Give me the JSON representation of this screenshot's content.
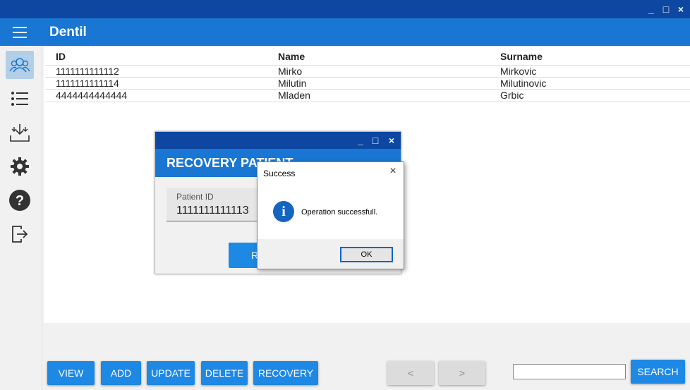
{
  "window": {
    "controls": [
      "_",
      "□",
      "×"
    ]
  },
  "appbar": {
    "title": "Dentil"
  },
  "sidebar": {
    "items": [
      {
        "name": "patients-icon",
        "active": true
      },
      {
        "name": "list-icon"
      },
      {
        "name": "download-icon"
      },
      {
        "name": "gear-icon"
      },
      {
        "name": "help-icon"
      },
      {
        "name": "logout-icon"
      }
    ]
  },
  "table": {
    "headers": [
      "ID",
      "Name",
      "Surname"
    ],
    "rows": [
      [
        "1111111111112",
        "Mirko",
        "Mirkovic"
      ],
      [
        "1111111111114",
        "Milutin",
        "Milutinovic"
      ],
      [
        "4444444444444",
        "Mladen",
        "Grbic"
      ]
    ]
  },
  "buttons": {
    "view": "VIEW",
    "add": "ADD",
    "update": "UPDATE",
    "delete": "DELETE",
    "recovery": "RECOVERY",
    "prev": "<",
    "next": ">",
    "search": "SEARCH"
  },
  "search": {
    "value": ""
  },
  "recovery_dialog": {
    "title": "RECOVERY PATIENT",
    "field_label": "Patient ID",
    "field_value": "1111111111113",
    "button_label": "RECOVERY"
  },
  "message_box": {
    "title": "Success",
    "text": "Operation successfull.",
    "ok": "OK"
  },
  "colors": {
    "primary": "#1976d2",
    "dark": "#0d47a1",
    "button": "#1e88e5"
  }
}
